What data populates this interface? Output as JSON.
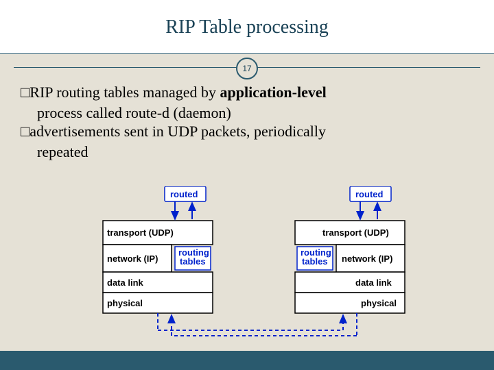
{
  "title": "RIP Table processing",
  "page_number": "17",
  "b1_pre": "RIP routing tables managed by ",
  "b1_bold": "application-level",
  "b1_cont": "process called route-d (daemon)",
  "b2": "advertisements sent in UDP packets, periodically",
  "b2_cont": "repeated",
  "bullet_glyph": "□",
  "diagram": {
    "routed": "routed",
    "transport": "transport (UDP)",
    "network": "network (IP)",
    "tables": "routing\ntables",
    "datalink": "data link",
    "physical": "physical"
  }
}
